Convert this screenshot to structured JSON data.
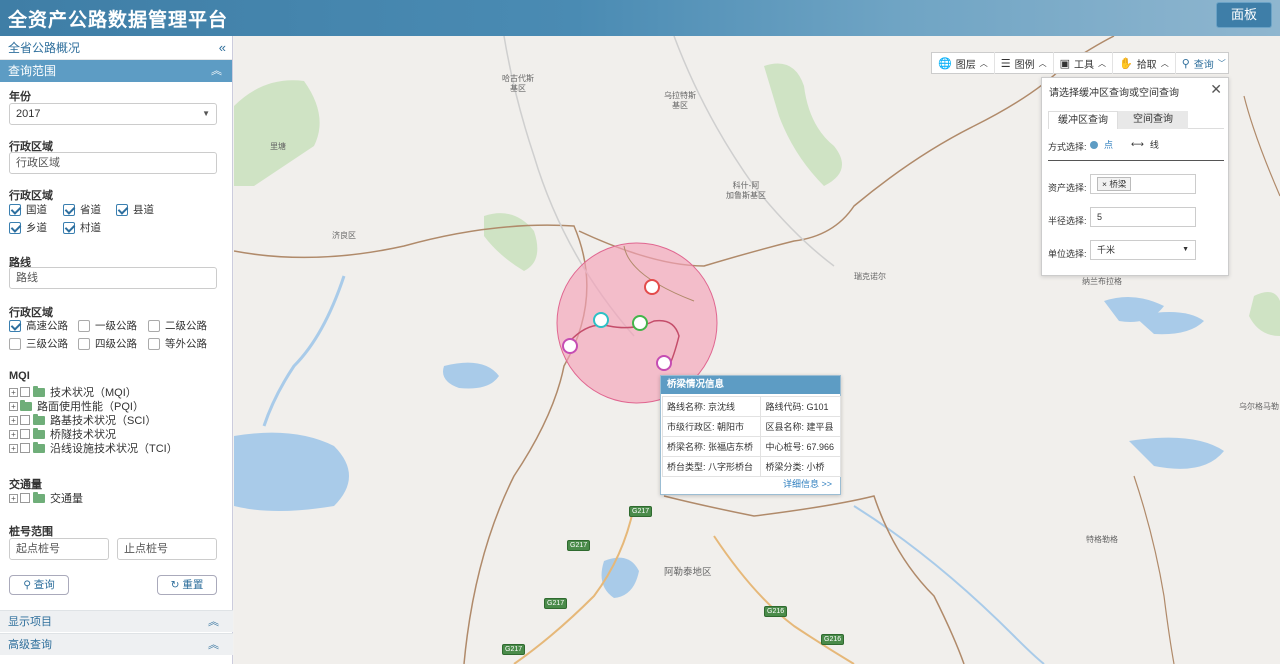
{
  "header": {
    "title": "全资产公路数据管理平台",
    "panel_label": "面板"
  },
  "sidebar": {
    "top_title": "全省公路概况",
    "collapse_icon": "«",
    "query_section": "查询范围",
    "year_label": "年份",
    "year_value": "2017",
    "admin_area_label": "行政区域",
    "admin_area_placeholder": "行政区域",
    "admin_area2_label": "行政区域",
    "road_types": [
      {
        "label": "国道",
        "checked": true
      },
      {
        "label": "省道",
        "checked": true
      },
      {
        "label": "县道",
        "checked": true
      },
      {
        "label": "乡道",
        "checked": true
      },
      {
        "label": "村道",
        "checked": true
      }
    ],
    "route_label": "路线",
    "route_placeholder": "路线",
    "admin_area3_label": "行政区域",
    "grades": [
      {
        "label": "高速公路",
        "checked": true
      },
      {
        "label": "一级公路",
        "checked": false
      },
      {
        "label": "二级公路",
        "checked": false
      },
      {
        "label": "三级公路",
        "checked": false
      },
      {
        "label": "四级公路",
        "checked": false
      },
      {
        "label": "等外公路",
        "checked": false
      }
    ],
    "mqi_label": "MQI",
    "mqi_items": [
      "技术状况（MQI）",
      "路面使用性能（PQI）",
      "路基技术状况（SCI）",
      "桥隧技术状况",
      "沿线设施技术状况（TCI）"
    ],
    "traffic_label": "交通量",
    "traffic_items": [
      "交通量"
    ],
    "stake_label": "桩号范围",
    "stake_start_placeholder": "起点桩号",
    "stake_end_placeholder": "止点桩号",
    "query_button": "查询",
    "reset_button": "重置",
    "display_items": "显示项目",
    "advanced_query": "高级查询"
  },
  "toolbar": {
    "items": [
      {
        "icon": "globe-icon",
        "label": "图层"
      },
      {
        "icon": "list-icon",
        "label": "图例"
      },
      {
        "icon": "toolbox-icon",
        "label": "工具"
      },
      {
        "icon": "hand-icon",
        "label": "拾取"
      },
      {
        "icon": "search-icon",
        "label": "查询"
      }
    ]
  },
  "query_panel": {
    "title": "请选择缓冲区查询或空间查询",
    "tabs": [
      "缓冲区查询",
      "空间查询"
    ],
    "mode_label": "方式选择:",
    "mode_point": "点",
    "mode_line": "线",
    "asset_label": "资产选择:",
    "asset_tag": "桥梁",
    "radius_label": "半径选择:",
    "radius_value": "5",
    "unit_label": "单位选择:",
    "unit_value": "千米"
  },
  "popup": {
    "title": "桥梁情况信息",
    "rows": [
      [
        "路线名称: 京沈线",
        "路线代码: G101"
      ],
      [
        "市级行政区: 朝阳市",
        "区县名称: 建平县"
      ],
      [
        "桥梁名称: 张福店东桥",
        "中心桩号: 67.966"
      ],
      [
        "桥台类型: 八字形桥台",
        "桥梁分类: 小桥"
      ]
    ],
    "more_link": "详细信息 >>"
  },
  "map_labels": {
    "l1": "哈古代斯\n基区",
    "l2": "乌拉特斯\n基区",
    "l3": "里塘",
    "l4": "科什-阿\n加鲁斯基区",
    "l5": "济良区",
    "l6": "瑞克诺尔",
    "l7": "纳兰布拉格",
    "l8": "乌尔格马勒",
    "l9": "特格勒格",
    "l10": "阿勒泰地区",
    "r1": "G217",
    "r2": "G217",
    "r3": "G217",
    "r4": "G217",
    "r5": "G216",
    "r6": "G216"
  },
  "colors": {
    "accent": "#5d9cc4",
    "header": "#3f7ea6",
    "buffer": "#f08aa6"
  }
}
